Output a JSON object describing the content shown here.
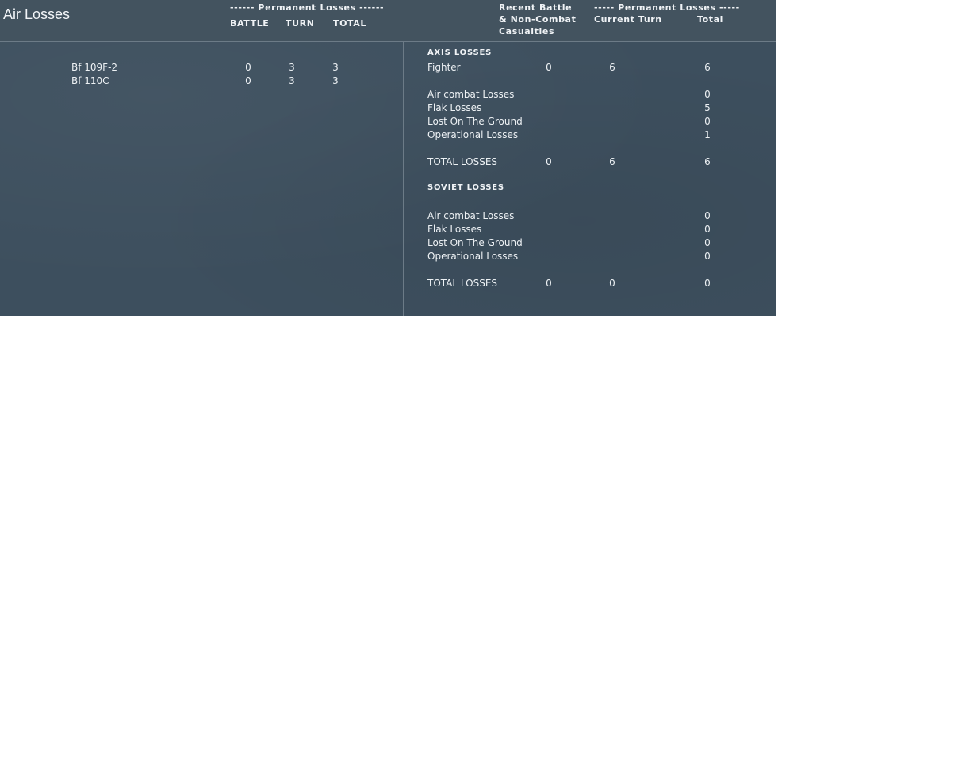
{
  "header": {
    "title": "Air Losses",
    "left_perm_label": "------ Permanent Losses ------",
    "left_cols": [
      "BATTLE",
      "TURN",
      "TOTAL"
    ],
    "recent_label": [
      "Recent Battle",
      "& Non-Combat",
      "Casualties"
    ],
    "right_perm_label": "----- Permanent Losses -----",
    "right_cols": [
      "Current Turn",
      "Total"
    ]
  },
  "aircraft": [
    {
      "name": "Bf 109F-2",
      "battle": "0",
      "turn": "3",
      "total": "3"
    },
    {
      "name": "Bf 110C",
      "battle": "0",
      "turn": "3",
      "total": "3"
    }
  ],
  "axis": {
    "heading": "AXIS LOSSES",
    "fighter": {
      "label": "Fighter",
      "recent": "0",
      "turn": "6",
      "total": "6"
    },
    "breakdown": [
      {
        "label": "Air combat Losses",
        "total": "0"
      },
      {
        "label": "Flak Losses",
        "total": "5"
      },
      {
        "label": "Lost On The Ground",
        "total": "0"
      },
      {
        "label": "Operational Losses",
        "total": "1"
      }
    ],
    "totals": {
      "label": "TOTAL LOSSES",
      "recent": "0",
      "turn": "6",
      "total": "6"
    }
  },
  "soviet": {
    "heading": "SOVIET LOSSES",
    "breakdown": [
      {
        "label": "Air combat Losses",
        "total": "0"
      },
      {
        "label": "Flak Losses",
        "total": "0"
      },
      {
        "label": "Lost On The Ground",
        "total": "0"
      },
      {
        "label": "Operational Losses",
        "total": "0"
      }
    ],
    "totals": {
      "label": "TOTAL LOSSES",
      "recent": "0",
      "turn": "0",
      "total": "0"
    }
  }
}
